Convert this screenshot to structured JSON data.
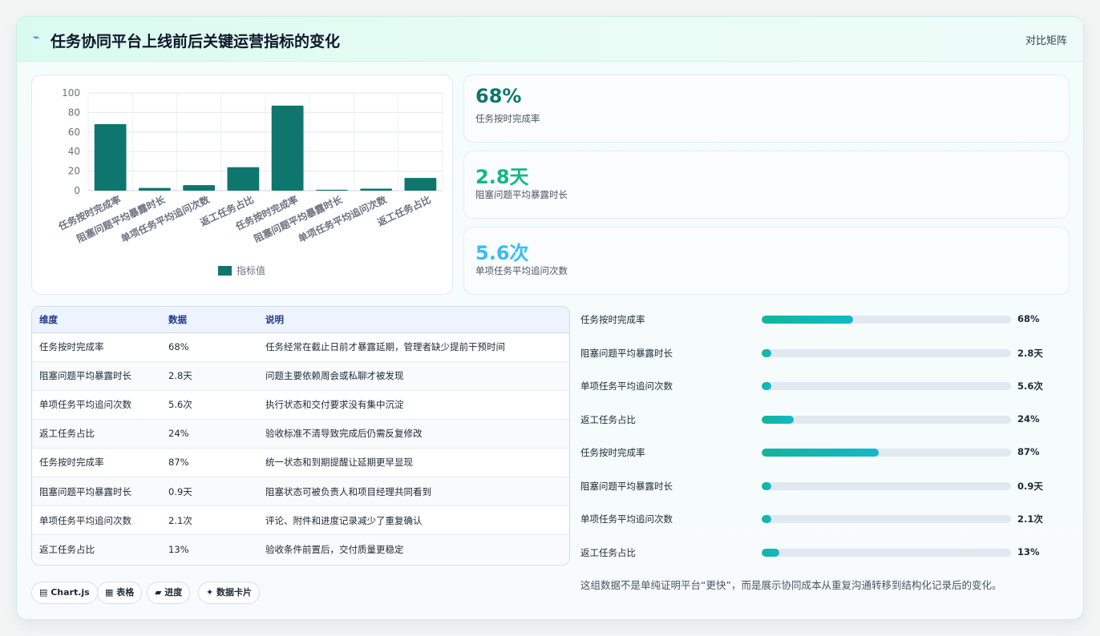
{
  "header": {
    "title": "任务协同平台上线前后关键运营指标的变化",
    "link": "对比矩阵"
  },
  "chart_data": {
    "type": "bar",
    "categories": [
      "任务按时完成率",
      "阻塞问题平均暴露时长",
      "单项任务平均追问次数",
      "返工任务占比",
      "任务按时完成率",
      "阻塞问题平均暴露时长",
      "单项任务平均追问次数",
      "返工任务占比"
    ],
    "series": [
      {
        "name": "指标值",
        "values": [
          68,
          2.8,
          5.6,
          24,
          87,
          0.9,
          2.1,
          13
        ]
      }
    ],
    "yticks": [
      "0",
      "20",
      "40",
      "60",
      "80",
      "100"
    ],
    "ylim": [
      0,
      100
    ],
    "grid": true,
    "legend": "bottom",
    "bar_color": "#0f766e"
  },
  "stats": [
    {
      "value": "68%",
      "label": "任务按时完成率",
      "color": "#0f766e"
    },
    {
      "value": "2.8天",
      "label": "阻塞问题平均暴露时长",
      "color": "#10b981"
    },
    {
      "value": "5.6次",
      "label": "单项任务平均追问次数",
      "color": "#38bdf8"
    }
  ],
  "table": {
    "headers": [
      "维度",
      "数据",
      "说明"
    ],
    "rows": [
      [
        "任务按时完成率",
        "68%",
        "任务经常在截止日前才暴露延期，管理者缺少提前干预时间"
      ],
      [
        "阻塞问题平均暴露时长",
        "2.8天",
        "问题主要依赖周会或私聊才被发现"
      ],
      [
        "单项任务平均追问次数",
        "5.6次",
        "执行状态和交付要求没有集中沉淀"
      ],
      [
        "返工任务占比",
        "24%",
        "验收标准不清导致完成后仍需反复修改"
      ],
      [
        "任务按时完成率",
        "87%",
        "统一状态和到期提醒让延期更早显现"
      ],
      [
        "阻塞问题平均暴露时长",
        "0.9天",
        "阻塞状态可被负责人和项目经理共同看到"
      ],
      [
        "单项任务平均追问次数",
        "2.1次",
        "评论、附件和进度记录减少了重复确认"
      ],
      [
        "返工任务占比",
        "13%",
        "验收条件前置后，交付质量更稳定"
      ]
    ]
  },
  "chips": [
    "▤ Chart.js",
    "▦ 表格",
    "▰ 进度",
    "✦ 数据卡片"
  ],
  "progress": [
    {
      "label": "任务按时完成率",
      "display": "68%",
      "fraction": 0.368
    },
    {
      "label": "阻塞问题平均暴露时长",
      "display": "2.8天",
      "fraction": 0.04
    },
    {
      "label": "单项任务平均追问次数",
      "display": "5.6次",
      "fraction": 0.04
    },
    {
      "label": "返工任务占比",
      "display": "24%",
      "fraction": 0.13
    },
    {
      "label": "任务按时完成率",
      "display": "87%",
      "fraction": 0.47
    },
    {
      "label": "阻塞问题平均暴露时长",
      "display": "0.9天",
      "fraction": 0.04
    },
    {
      "label": "单项任务平均追问次数",
      "display": "2.1次",
      "fraction": 0.04
    },
    {
      "label": "返工任务占比",
      "display": "13%",
      "fraction": 0.07
    }
  ],
  "note": "这组数据不是单纯证明平台“更快”，而是展示协同成本从重复沟通转移到结构化记录后的变化。"
}
